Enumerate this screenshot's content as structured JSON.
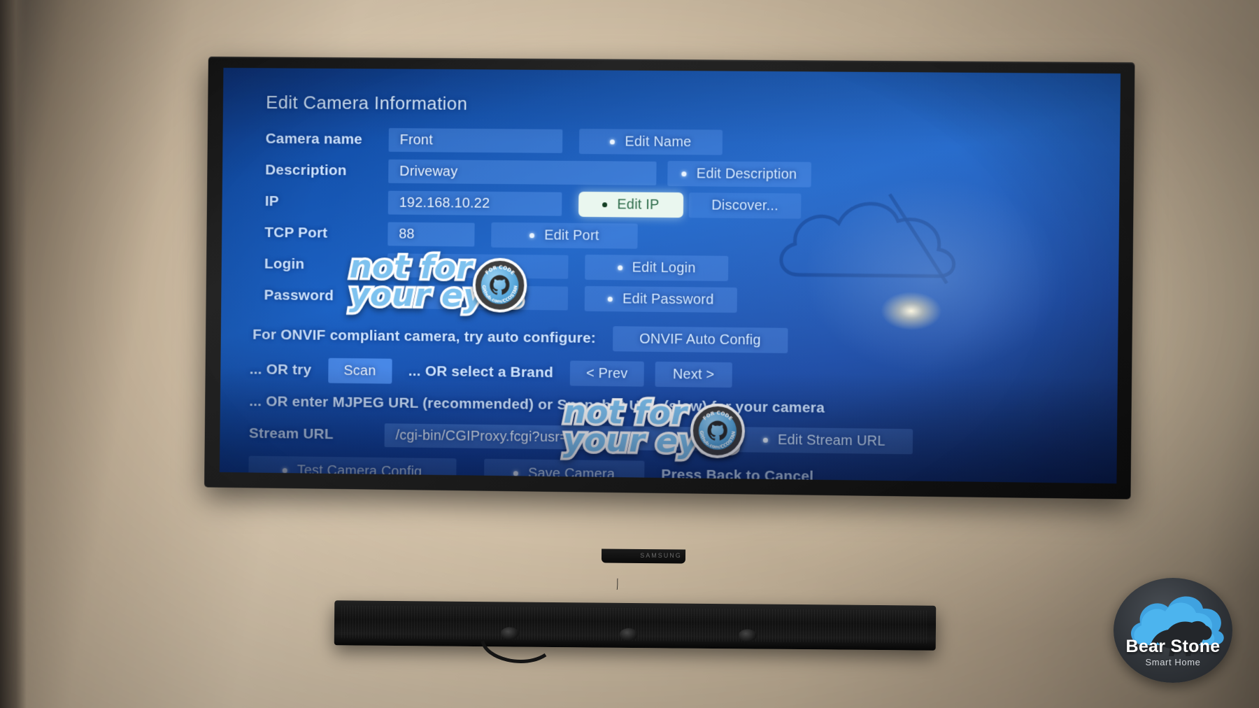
{
  "screen": {
    "title": "Edit Camera Information",
    "fields": [
      {
        "label": "Camera name",
        "value": "Front",
        "action": "Edit Name",
        "action_state": "normal"
      },
      {
        "label": "Description",
        "value": "Driveway",
        "action": "Edit Description",
        "action_state": "normal"
      },
      {
        "label": "IP",
        "value": "192.168.10.22",
        "action": "Edit IP",
        "action_state": "focused",
        "extra_action": "Discover..."
      },
      {
        "label": "TCP Port",
        "value": "88",
        "action": "Edit Port",
        "action_state": "normal"
      },
      {
        "label": "Login",
        "value": "",
        "action": "Edit Login",
        "action_state": "normal"
      },
      {
        "label": "Password",
        "value": "",
        "action": "Edit Password",
        "action_state": "normal"
      }
    ],
    "onvif": {
      "prompt": "For ONVIF compliant camera, try auto configure:",
      "button": "ONVIF Auto Config"
    },
    "scan": {
      "prefix": "... OR try",
      "scan_button": "Scan",
      "middle": "... OR select a Brand",
      "prev_button": "< Prev",
      "next_button": "Next >"
    },
    "mjpeg_note": "... OR enter MJPEG URL (recommended) or Snapshot URL (slow) for your camera",
    "stream": {
      "label": "Stream URL",
      "value": "/cgi-bin/CGIProxy.fcgi?usr=",
      "action": "Edit Stream URL"
    },
    "actions": {
      "test": "Test Camera Config",
      "save": "Save Camera",
      "cancel_hint": "Press Back to Cancel"
    }
  },
  "watermarks": [
    {
      "line1": "not for",
      "line2": "your eyes",
      "badge_top": "FOR CODE",
      "badge_bottom": "Github.com/CCOSTAN"
    },
    {
      "line1": "not for",
      "line2": "your eyes",
      "badge_top": "FOR CODE",
      "badge_bottom": "Github.com/CCOSTAN"
    }
  ],
  "brand": {
    "name": "Bear Stone",
    "tagline": "Smart Home"
  },
  "device": {
    "tv_logo": "SAMSUNG"
  },
  "colors": {
    "screen_blue": "#1452ad",
    "field_blue": "#78afff",
    "focus_cream": "#eaf7ef",
    "text_light": "#cfe5ff",
    "brand_cloud": "#3fa2e0"
  }
}
